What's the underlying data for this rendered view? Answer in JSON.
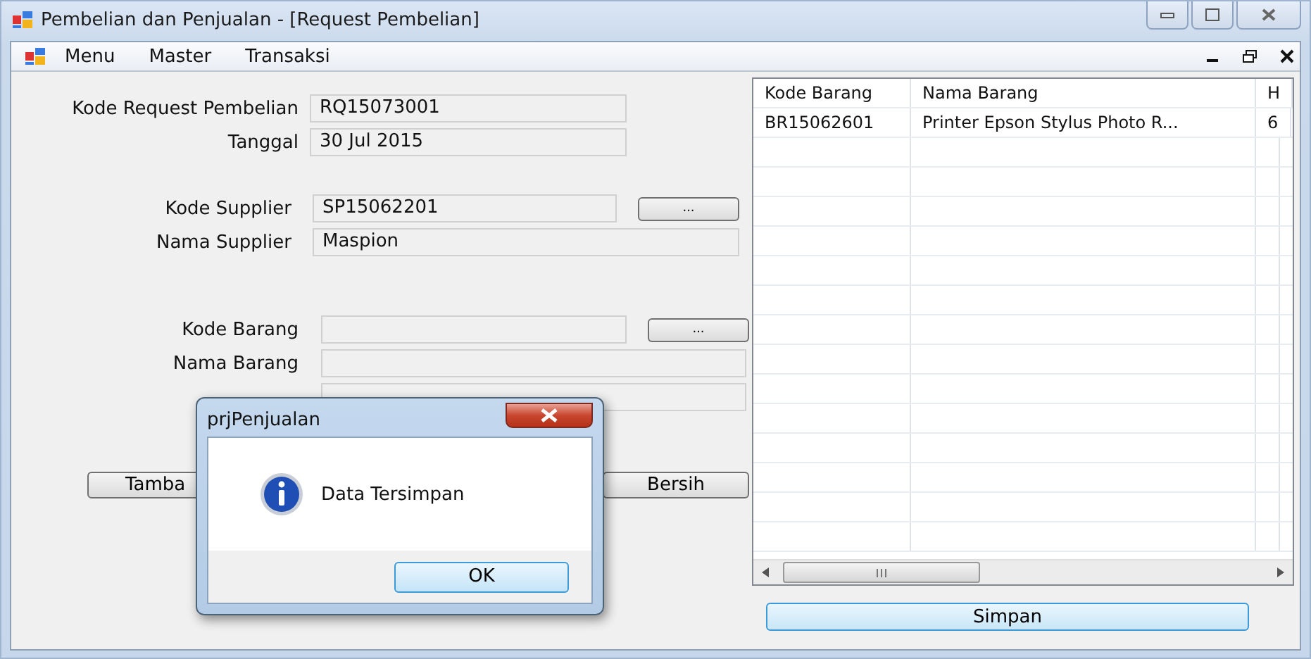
{
  "window": {
    "title": "Pembelian dan Penjualan - [Request Pembelian]"
  },
  "menu": [
    "Menu",
    "Master",
    "Transaksi"
  ],
  "form": {
    "groups": [
      {
        "fields": [
          {
            "kind": "textbox",
            "label": "Kode Request Pembelian",
            "value": "RQ15073001"
          },
          {
            "kind": "textbox",
            "label": "Tanggal",
            "value": "30 Jul 2015"
          }
        ]
      },
      {
        "fields": [
          {
            "kind": "textbox",
            "label": "Kode Supplier",
            "value": "SP15062201",
            "browse": "..."
          },
          {
            "kind": "textbox",
            "label": "Nama Supplier",
            "value": "Maspion"
          }
        ]
      },
      {
        "fields": [
          {
            "kind": "textbox",
            "label": "Kode Barang",
            "browse": "..."
          },
          {
            "kind": "textbox",
            "label": "Nama Barang"
          },
          {
            "kind": "textbox"
          }
        ]
      }
    ]
  },
  "buttons": [
    {
      "label": "Tamba"
    },
    {
      "label": "Bersih"
    }
  ],
  "grid": {
    "columns": [
      "Kode Barang",
      "Nama Barang",
      "H"
    ],
    "rows": [
      [
        "BR15062601",
        "Printer Epson Stylus Photo R...",
        "6"
      ]
    ]
  },
  "save_button": "Simpan",
  "dialog": {
    "title": "prjPenjualan",
    "message": "Data Tersimpan",
    "button": "OK"
  }
}
